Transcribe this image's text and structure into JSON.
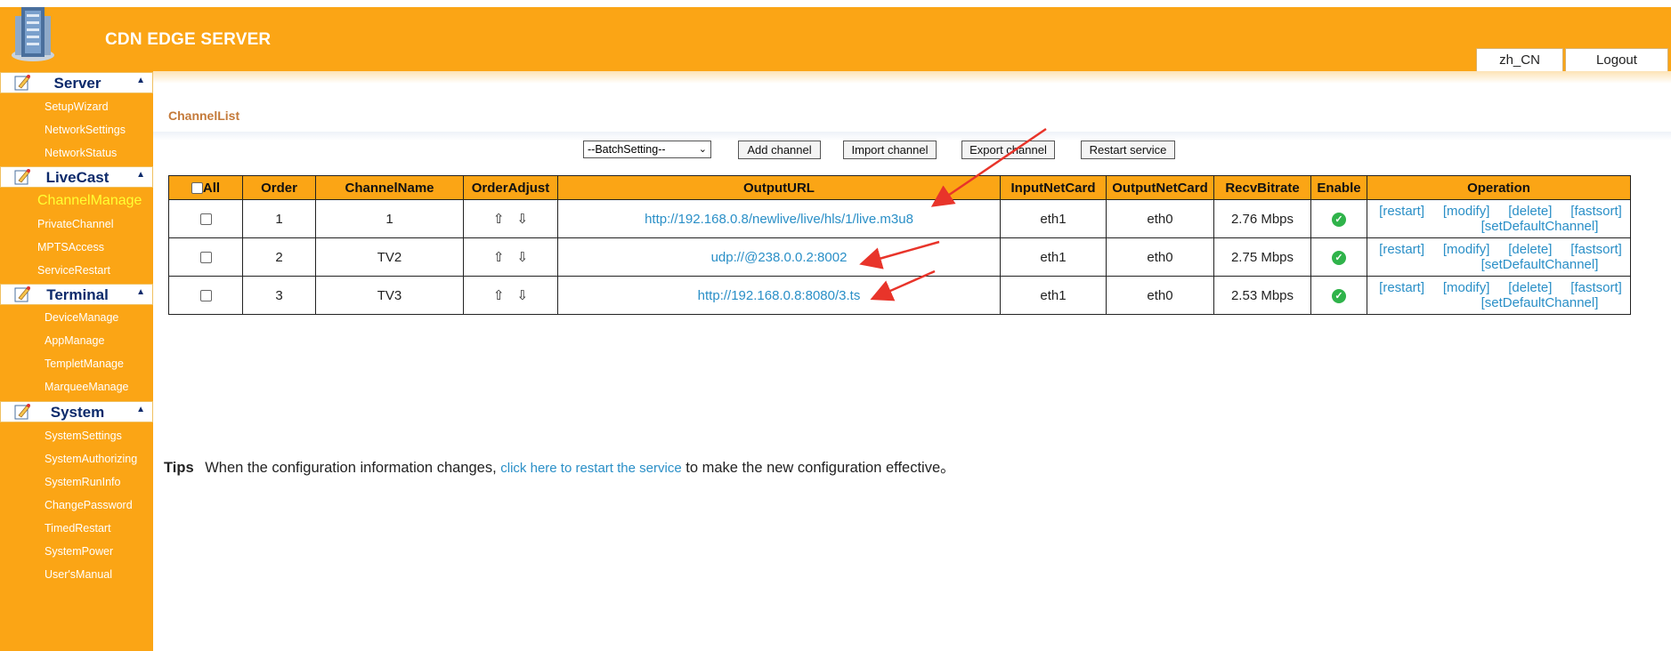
{
  "header": {
    "app_title": "CDN EDGE SERVER",
    "lang_label": "zh_CN",
    "logout_label": "Logout",
    "accent_color": "#fba515"
  },
  "sidebar": {
    "sections": [
      {
        "title": "Server",
        "items": [
          "SetupWizard",
          "NetworkSettings",
          "NetworkStatus"
        ]
      },
      {
        "title": "LiveCast",
        "items": [
          "ChannelManage",
          "PrivateChannel",
          "MPTSAccess",
          "ServiceRestart"
        ]
      },
      {
        "title": "Terminal",
        "items": [
          "DeviceManage",
          "AppManage",
          "TempletManage",
          "MarqueeManage"
        ]
      },
      {
        "title": "System",
        "items": [
          "SystemSettings",
          "SystemAuthorizing",
          "SystemRunInfo",
          "ChangePassword",
          "TimedRestart",
          "SystemPower",
          "User'sManual"
        ]
      }
    ],
    "active_item": "ChannelManage",
    "active_color": "#ffff33"
  },
  "page": {
    "title": "ChannelList"
  },
  "toolbar": {
    "batch_select": "--BatchSetting--",
    "add_label": "Add channel",
    "import_label": "Import channel",
    "export_label": "Export channel",
    "restart_label": "Restart service"
  },
  "table": {
    "headers": [
      "All",
      "Order",
      "ChannelName",
      "OrderAdjust",
      "OutputURL",
      "InputNetCard",
      "OutputNetCard",
      "RecvBitrate",
      "Enable",
      "Operation"
    ],
    "rows": [
      {
        "order": "1",
        "name": "1",
        "url": "http://192.168.0.8/newlive/live/hls/1/live.m3u8",
        "input": "eth1",
        "output": "eth0",
        "bitrate": "2.76 Mbps"
      },
      {
        "order": "2",
        "name": "TV2",
        "url": "udp://@238.0.0.2:8002",
        "input": "eth1",
        "output": "eth0",
        "bitrate": "2.75 Mbps"
      },
      {
        "order": "3",
        "name": "TV3",
        "url": "http://192.168.0.8:8080/3.ts",
        "input": "eth1",
        "output": "eth0",
        "bitrate": "2.53 Mbps"
      }
    ],
    "ops": {
      "restart": "[restart]",
      "modify": "[modify]",
      "delete": "[delete]",
      "fastsort": "[fastsort]",
      "default": "[setDefaultChannel]"
    },
    "arrow_up_icon": "arrow-up-icon",
    "arrow_down_icon": "arrow-down-icon",
    "enable_icon": "check-circle-icon",
    "link_color": "#2a8fc7",
    "enable_color": "#2fb34a"
  },
  "tips": {
    "label": "Tips",
    "before": "When the configuration information changes,",
    "link": "click here to restart the service",
    "after": "to make the new configuration effective。"
  },
  "annotation_color": "#e8342a"
}
